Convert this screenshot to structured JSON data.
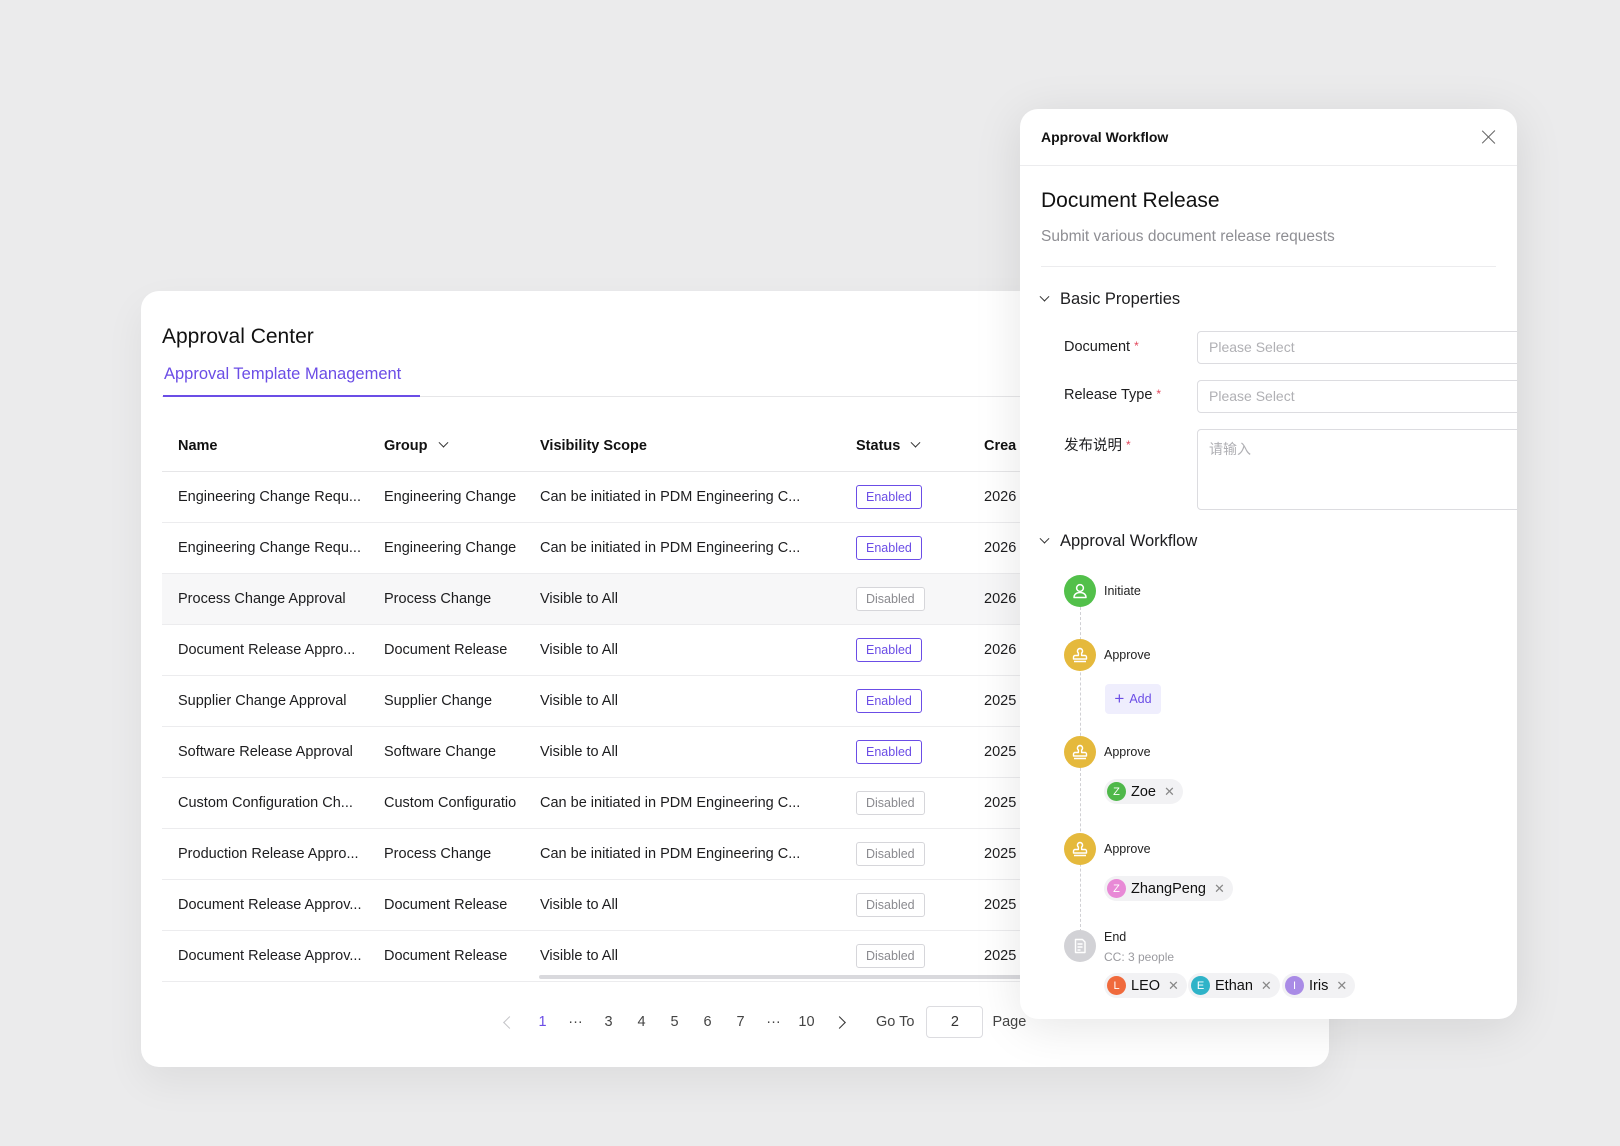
{
  "app": {
    "title": "Approval Center",
    "tab": "Approval Template Management"
  },
  "table": {
    "headers": {
      "name": "Name",
      "group": "Group",
      "visibility": "Visibility Scope",
      "status": "Status",
      "created": "Crea"
    },
    "rows": [
      {
        "name": "Engineering Change Requ...",
        "group": "Engineering Change",
        "visibility": "Can be initiated in PDM Engineering C...",
        "status": "Enabled",
        "created": "2026"
      },
      {
        "name": "Engineering Change Requ...",
        "group": "Engineering Change",
        "visibility": "Can be initiated in PDM Engineering C...",
        "status": "Enabled",
        "created": "2026"
      },
      {
        "name": "Process Change Approval",
        "group": "Process Change",
        "visibility": "Visible to All",
        "status": "Disabled",
        "created": "2026"
      },
      {
        "name": "Document Release Appro...",
        "group": "Document Release",
        "visibility": "Visible to All",
        "status": "Enabled",
        "created": "2026"
      },
      {
        "name": "Supplier Change Approval",
        "group": "Supplier Change",
        "visibility": "Visible to All",
        "status": "Enabled",
        "created": "2025"
      },
      {
        "name": "Software Release Approval",
        "group": "Software Change",
        "visibility": "Visible to All",
        "status": "Enabled",
        "created": "2025"
      },
      {
        "name": "Custom Configuration Ch...",
        "group": "Custom Configuratio",
        "visibility": "Can be initiated in PDM Engineering C...",
        "status": "Disabled",
        "created": "2025"
      },
      {
        "name": "Production Release Appro...",
        "group": "Process Change",
        "visibility": "Can be initiated in PDM Engineering C...",
        "status": "Disabled",
        "created": "2025"
      },
      {
        "name": "Document Release Approv...",
        "group": "Document Release",
        "visibility": "Visible to All",
        "status": "Disabled",
        "created": "2025"
      },
      {
        "name": "Document Release Approv...",
        "group": "Document Release",
        "visibility": "Visible to All",
        "status": "Disabled",
        "created": "2025"
      }
    ]
  },
  "pagination": {
    "pages": [
      "1",
      "···",
      "3",
      "4",
      "5",
      "6",
      "7",
      "···",
      "10"
    ],
    "current": "1",
    "goto_label": "Go To",
    "goto_value": "2",
    "page_label": "Page"
  },
  "panel": {
    "header_title": "Approval Workflow",
    "doc_title": "Document Release",
    "doc_subtitle": "Submit various document release requests",
    "basic_section": "Basic Properties",
    "fields": {
      "document_label": "Document",
      "document_placeholder": "Please Select",
      "release_type_label": "Release Type",
      "release_type_placeholder": "Please Select",
      "notes_label": "发布说明",
      "notes_placeholder": "请输入",
      "required_mark": "*"
    },
    "workflow_section": "Approval Workflow",
    "workflow": {
      "initiate": "Initiate",
      "approve_1": "Approve",
      "add_label": "Add",
      "approve_2": "Approve",
      "approve_2_person": {
        "initial": "Z",
        "name": "Zoe",
        "color": "#4fb84a"
      },
      "approve_3": "Approve",
      "approve_3_person": {
        "initial": "Z",
        "name": "ZhangPeng",
        "color": "#e889d6"
      },
      "end": "End",
      "cc_text": "CC: 3 people",
      "cc_people": [
        {
          "initial": "L",
          "name": "LEO",
          "color": "#f06a3c"
        },
        {
          "initial": "E",
          "name": "Ethan",
          "color": "#2fb3c8"
        },
        {
          "initial": "I",
          "name": "Iris",
          "color": "#a98be6"
        }
      ]
    }
  },
  "colors": {
    "accent": "#6b4de6",
    "required": "#e2465b",
    "initiate_node": "#52c04a",
    "approve_node": "#e5b93c"
  },
  "icons": [
    "close-icon",
    "chevron-down-icon",
    "user-icon",
    "stamp-icon",
    "document-icon",
    "chevron-left-icon",
    "chevron-right-icon",
    "plus-icon",
    "remove-icon"
  ]
}
